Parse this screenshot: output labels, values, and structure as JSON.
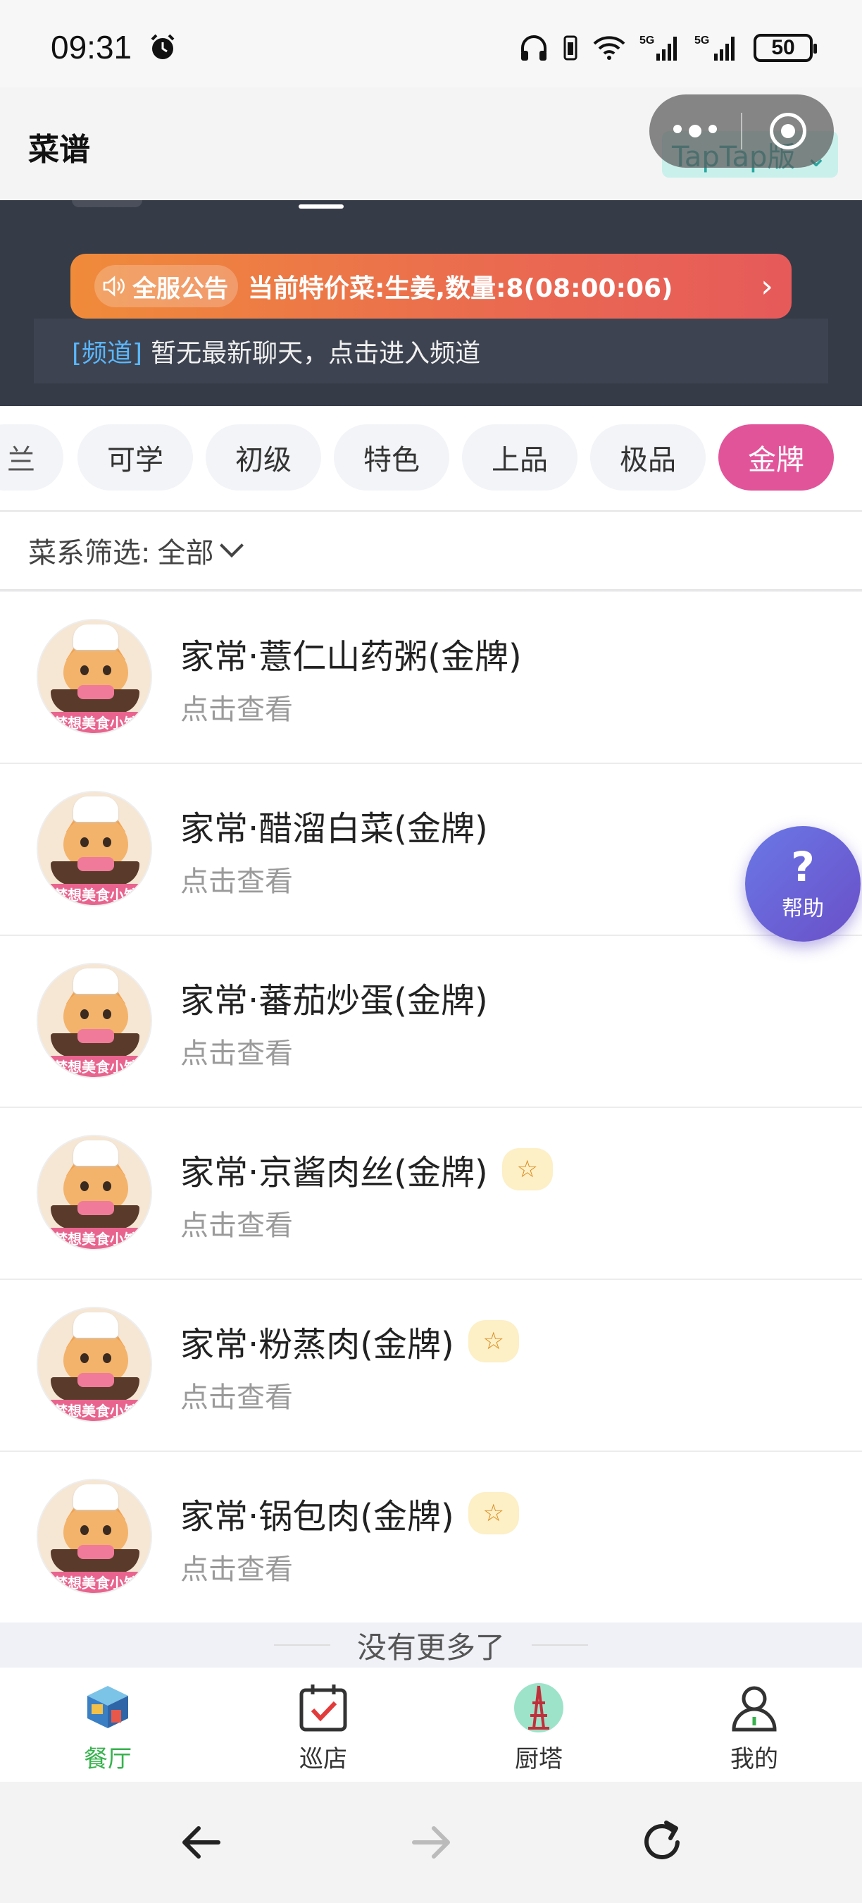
{
  "status": {
    "time": "09:31",
    "battery": "50",
    "net1": "5G",
    "net2": "5G"
  },
  "header": {
    "title": "菜谱",
    "taptap": "TapTap版"
  },
  "notice": {
    "tag": "全服公告",
    "text": "当前特价菜:生姜,数量:8(08:00:06)"
  },
  "chat": {
    "tag": "[频道]",
    "text": "暂无最新聊天，点击进入频道"
  },
  "levels": {
    "cut": "兰",
    "items": [
      "可学",
      "初级",
      "特色",
      "上品",
      "极品",
      "金牌"
    ],
    "active_index": 5
  },
  "cuisine_filter": {
    "label": "菜系筛选:",
    "value": "全部"
  },
  "dishes": [
    {
      "name": "家常·薏仁山药粥(金牌)",
      "sub": "点击查看",
      "star": false
    },
    {
      "name": "家常·醋溜白菜(金牌)",
      "sub": "点击查看",
      "star": false
    },
    {
      "name": "家常·蕃茄炒蛋(金牌)",
      "sub": "点击查看",
      "star": false
    },
    {
      "name": "家常·京酱肉丝(金牌)",
      "sub": "点击查看",
      "star": true
    },
    {
      "name": "家常·粉蒸肉(金牌)",
      "sub": "点击查看",
      "star": true
    },
    {
      "name": "家常·锅包肉(金牌)",
      "sub": "点击查看",
      "star": true
    }
  ],
  "avatar_text": "梦想美食小馆",
  "star_glyph": "☆",
  "no_more": "没有更多了",
  "help": {
    "icon": "?",
    "label": "帮助"
  },
  "tabs": [
    {
      "label": "餐厅",
      "icon": "restaurant-icon",
      "active": true
    },
    {
      "label": "巡店",
      "icon": "calendar-check-icon",
      "active": false
    },
    {
      "label": "厨塔",
      "icon": "tower-icon",
      "active": false
    },
    {
      "label": "我的",
      "icon": "user-icon",
      "active": false
    }
  ],
  "colors": {
    "accent_pink": "#e2549a",
    "active_tab": "#37b24d",
    "help": "#6a5fd6",
    "notice": "#ec7044"
  }
}
